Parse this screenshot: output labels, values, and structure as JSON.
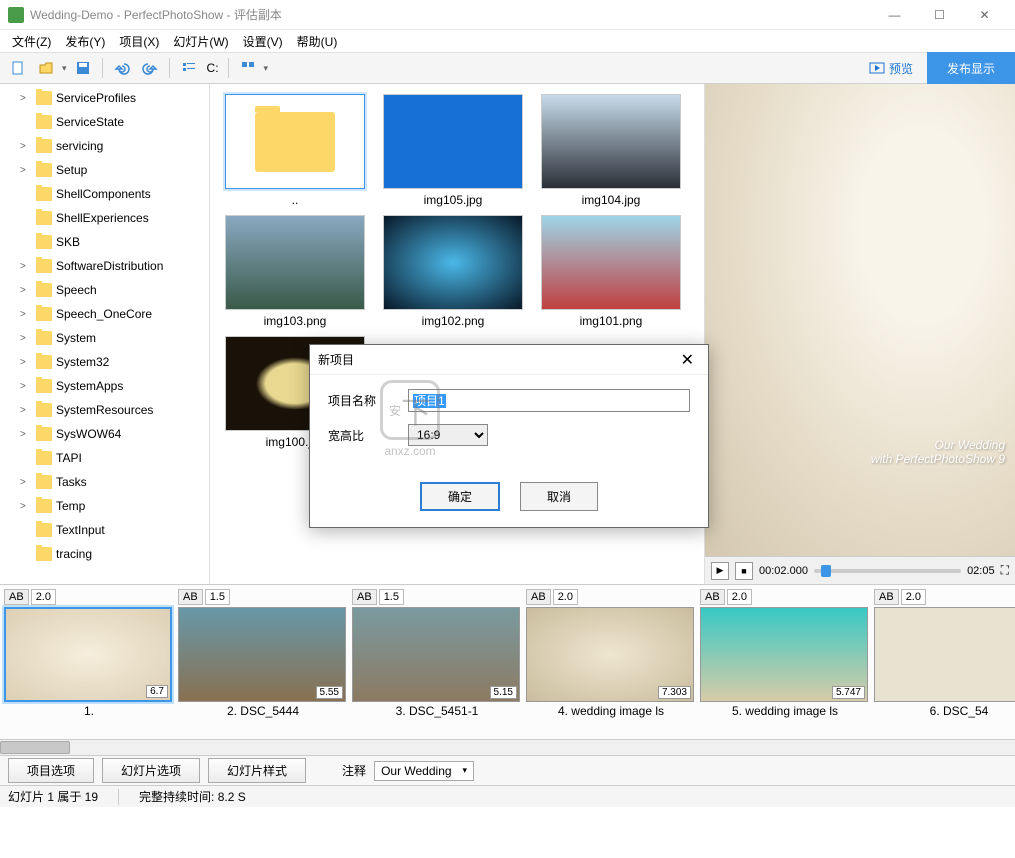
{
  "title": "Wedding-Demo - PerfectPhotoShow - 评估副本",
  "menu": {
    "file": "文件(Z)",
    "publish": "发布(Y)",
    "project": "项目(X)",
    "slide": "幻灯片(W)",
    "settings": "设置(V)",
    "help": "帮助(U)"
  },
  "toolbar": {
    "drive": "C:",
    "preview": "预览",
    "publish": "发布显示"
  },
  "tree": [
    {
      "label": "ServiceProfiles",
      "arrow": ">"
    },
    {
      "label": "ServiceState",
      "arrow": ""
    },
    {
      "label": "servicing",
      "arrow": ">"
    },
    {
      "label": "Setup",
      "arrow": ">"
    },
    {
      "label": "ShellComponents",
      "arrow": ""
    },
    {
      "label": "ShellExperiences",
      "arrow": ""
    },
    {
      "label": "SKB",
      "arrow": ""
    },
    {
      "label": "SoftwareDistribution",
      "arrow": ">"
    },
    {
      "label": "Speech",
      "arrow": ">"
    },
    {
      "label": "Speech_OneCore",
      "arrow": ">"
    },
    {
      "label": "System",
      "arrow": ">"
    },
    {
      "label": "System32",
      "arrow": ">"
    },
    {
      "label": "SystemApps",
      "arrow": ">"
    },
    {
      "label": "SystemResources",
      "arrow": ">"
    },
    {
      "label": "SysWOW64",
      "arrow": ">"
    },
    {
      "label": "TAPI",
      "arrow": ""
    },
    {
      "label": "Tasks",
      "arrow": ">"
    },
    {
      "label": "Temp",
      "arrow": ">"
    },
    {
      "label": "TextInput",
      "arrow": ""
    },
    {
      "label": "tracing",
      "arrow": ""
    }
  ],
  "thumbs": [
    {
      "name": "..",
      "type": "folder"
    },
    {
      "name": "img105.jpg",
      "type": "img",
      "bg": "#1670d6"
    },
    {
      "name": "img104.jpg",
      "type": "img",
      "bg": "linear-gradient(#c8dbea,#2a3038)"
    },
    {
      "name": "img103.png",
      "type": "img",
      "bg": "linear-gradient(#8aa8c0,#3a5a4a)"
    },
    {
      "name": "img102.png",
      "type": "img",
      "bg": "radial-gradient(#4ab8e8,#081828)"
    },
    {
      "name": "img101.png",
      "type": "img",
      "bg": "linear-gradient(#9fd5e8,#c04040)"
    },
    {
      "name": "img100.jpg",
      "type": "img",
      "bg": "radial-gradient(#e8d890 30%,#1a1208 40%)"
    }
  ],
  "preview": {
    "line1": "Our Wedding",
    "line2": "with PerfectPhotoShow 9"
  },
  "player": {
    "cur": "00:02.000",
    "total": "02:05"
  },
  "slides": [
    {
      "ab": "AB",
      "abdur": "2.0",
      "badge": "6.7",
      "label": "1.",
      "selected": true,
      "bg": "radial-gradient(#f6eedc,#dccfb4)"
    },
    {
      "ab": "AB",
      "abdur": "1.5",
      "badge": "5.55",
      "label": "2. DSC_5444",
      "bg": "linear-gradient(#6898a8,#887050)"
    },
    {
      "ab": "AB",
      "abdur": "1.5",
      "badge": "5.15",
      "label": "3. DSC_5451-1",
      "bg": "linear-gradient(#7a9aa0,#8c7a62)"
    },
    {
      "ab": "AB",
      "abdur": "2.0",
      "badge": "7.303",
      "label": "4. wedding image ls",
      "bg": "radial-gradient(#efe6d0,#cabd9e)"
    },
    {
      "ab": "AB",
      "abdur": "2.0",
      "badge": "5.747",
      "label": "5. wedding image ls",
      "bg": "linear-gradient(#38c8c4,#d8cca8)"
    },
    {
      "ab": "AB",
      "abdur": "2.0",
      "badge": "",
      "label": "6. DSC_54",
      "bg": "#e8e3d0"
    }
  ],
  "bottom": {
    "proj_opts": "项目选项",
    "slide_opts": "幻灯片选项",
    "slide_style": "幻灯片样式",
    "note_label": "注释",
    "note_value": "Our Wedding"
  },
  "status": {
    "slide_pos": "幻灯片 1 属于 19",
    "duration": "完整持续时间: 8.2 S"
  },
  "dialog": {
    "title": "新项目",
    "name_label": "项目名称",
    "name_value": "项目1",
    "ratio_label": "宽高比",
    "ratio_value": "16:9",
    "ok": "确定",
    "cancel": "取消"
  },
  "watermark": {
    "text": "anxz.com",
    "glyph": "安"
  }
}
